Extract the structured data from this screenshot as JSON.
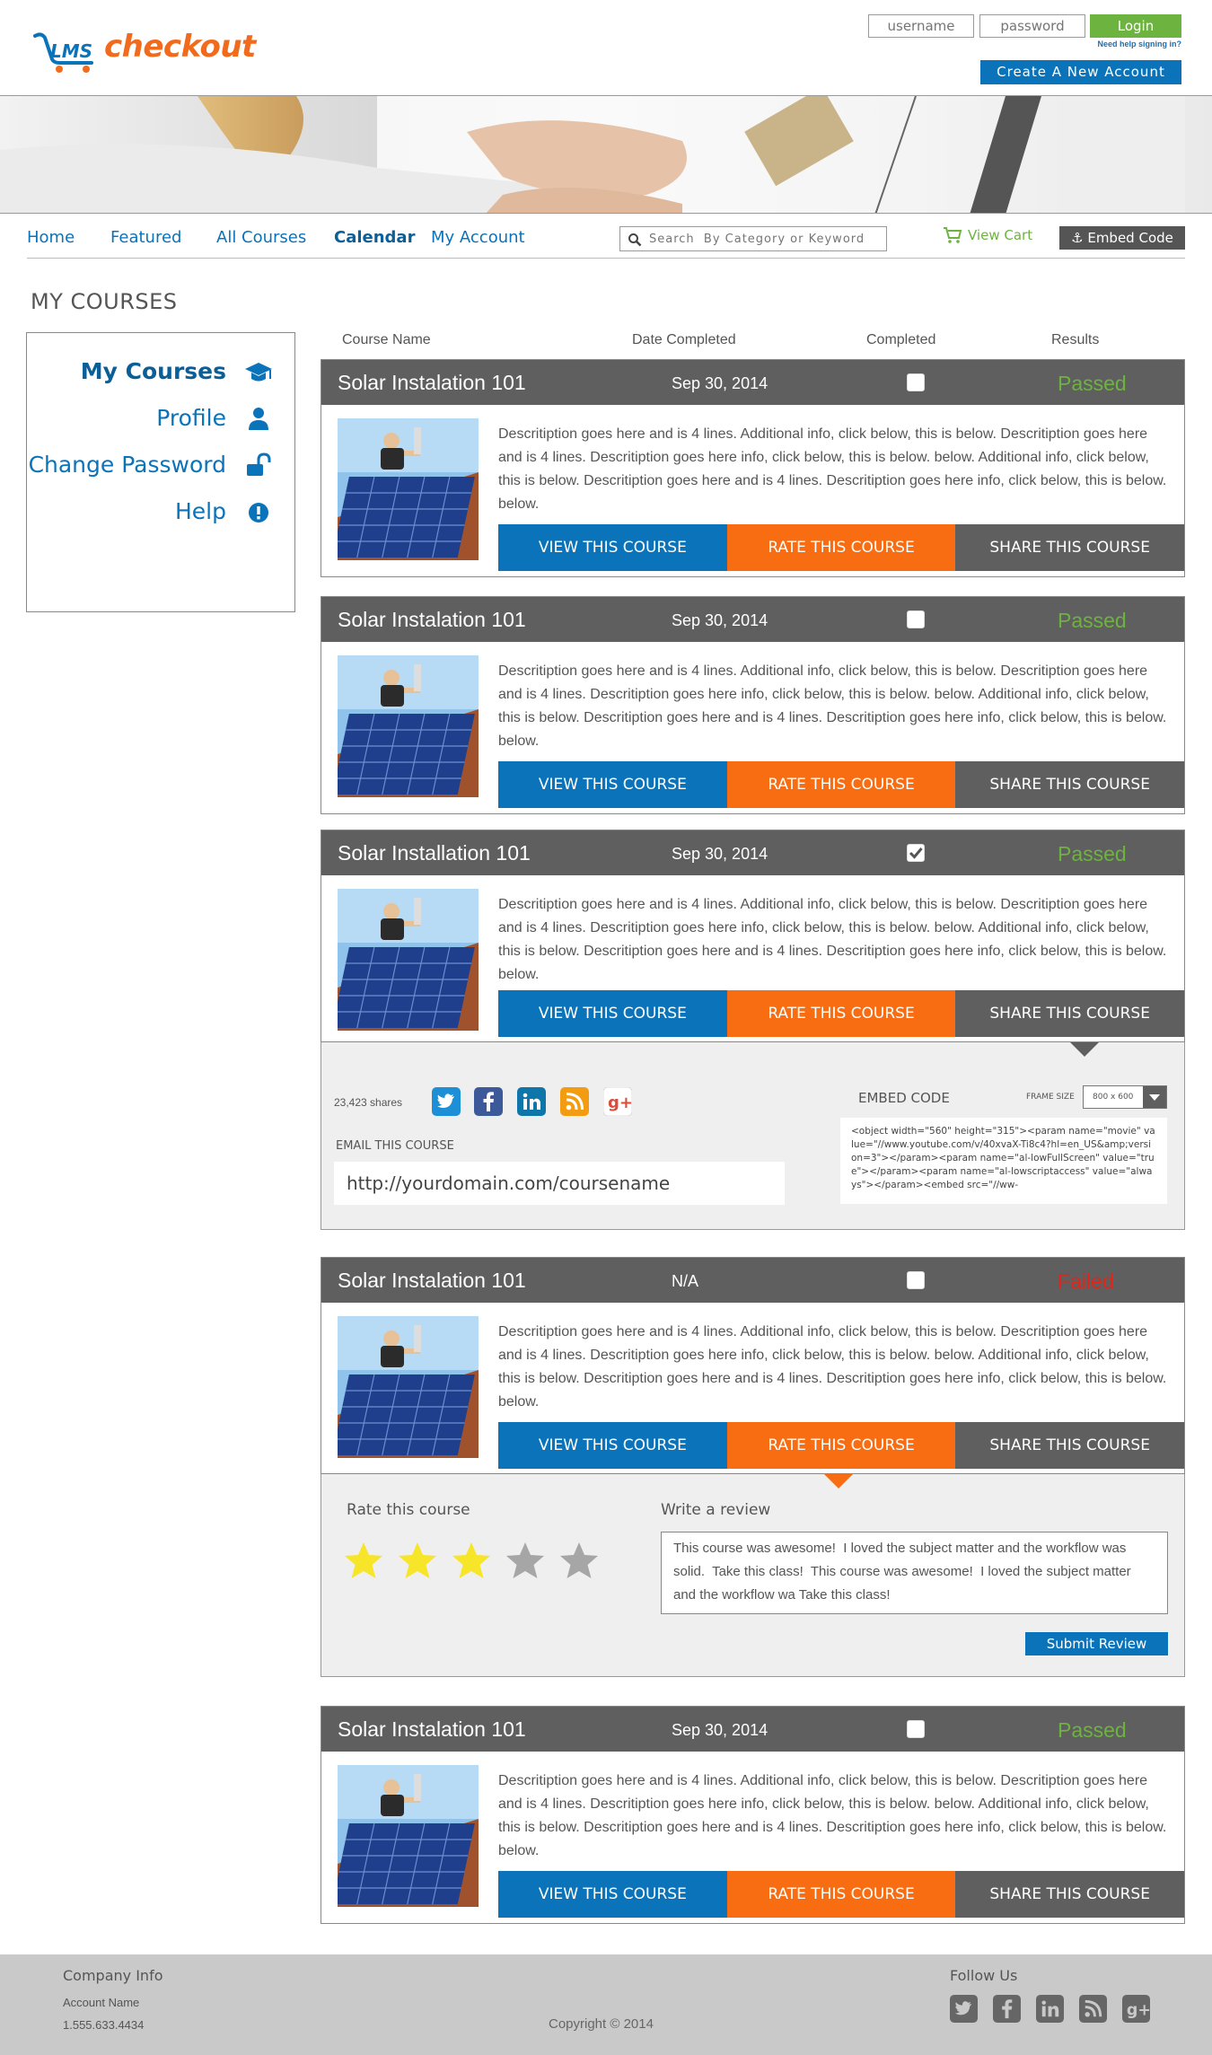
{
  "header": {
    "logo_text": "checkout",
    "logo_mark": "LMS",
    "username_placeholder": "username",
    "password_placeholder": "password",
    "login_label": "Login",
    "help_link": "Need help signing in?",
    "create_account_label": "Create  A  New  Account"
  },
  "nav": {
    "items": [
      "Home",
      "Featured",
      "All Courses",
      "Calendar",
      "My Account"
    ],
    "active": "Calendar",
    "search_placeholder": "Search  By Category or Keyword",
    "cart_label": "View Cart",
    "embed_label": "Embed Code"
  },
  "page_title": "MY COURSES",
  "sidebar": {
    "items": [
      {
        "label": "My Courses",
        "icon": "graduation-cap-icon",
        "active": true
      },
      {
        "label": "Profile",
        "icon": "user-icon",
        "active": false
      },
      {
        "label": "Change Password",
        "icon": "unlock-icon",
        "active": false
      },
      {
        "label": "Help",
        "icon": "exclamation-circle-icon",
        "active": false
      }
    ]
  },
  "columns": [
    "Course Name",
    "Date Completed",
    "Completed",
    "Results"
  ],
  "course_buttons": {
    "view": "VIEW THIS COURSE",
    "rate": "RATE THIS COURSE",
    "share": "SHARE THIS COURSE"
  },
  "courses": [
    {
      "name": "Solar Instalation 101",
      "date": "Sep 30, 2014",
      "completed": false,
      "result": "Passed",
      "result_color": "#6db33f",
      "description": "Descritiption goes here and is 4 lines.  Additional info, click below, this is below. Descritiption goes here and is 4 lines.  Descritiption goes here info, click below, this is below. below.  Additional info, click below, this is below. Descritiption goes here and is 4 lines.  Descritiption goes here info, click below, this is below. below."
    },
    {
      "name": "Solar Instalation 101",
      "date": "Sep 30, 2014",
      "completed": false,
      "result": "Passed",
      "result_color": "#6db33f",
      "description": "Descritiption goes here and is 4 lines.  Additional info, click below, this is below. Descritiption goes here and is 4 lines.  Descritiption goes here info, click below, this is below. below.  Additional info, click below, this is below. Descritiption goes here and is 4 lines.  Descritiption goes here info, click below, this is below. below."
    },
    {
      "name": "Solar Installation 101",
      "date": "Sep 30, 2014",
      "completed": true,
      "result": "Passed",
      "result_color": "#6db33f",
      "description": "Descritiption goes here and is 4 lines.  Additional info, click below, this is below. Descritiption goes here and is 4 lines.  Descritiption goes here info, click below, this is below. below.  Additional info, click below, this is below. Descritiption goes here and is 4 lines.  Descritiption goes here info, click below, this is below. below."
    },
    {
      "name": "Solar Instalation 101",
      "date": "N/A",
      "completed": false,
      "result": "Failed",
      "result_color": "#e0251b",
      "description": "Descritiption goes here and is 4 lines.  Additional info, click below, this is below. Descritiption goes here and is 4 lines.  Descritiption goes here info, click below, this is below. below.  Additional info, click below, this is below. Descritiption goes here and is 4 lines.  Descritiption goes here info, click below, this is below. below."
    },
    {
      "name": "Solar Instalation 101",
      "date": "Sep 30, 2014",
      "completed": false,
      "result": "Passed",
      "result_color": "#6db33f",
      "description": "Descritiption goes here and is 4 lines.  Additional info, click below, this is below. Descritiption goes here and is 4 lines.  Descritiption goes here info, click below, this is below. below.  Additional info, click below, this is below. Descritiption goes here and is 4 lines.  Descritiption goes here info, click below, this is below. below."
    }
  ],
  "share_panel": {
    "share_count": "23,423 shares",
    "social_icons": [
      "twitter-icon",
      "facebook-icon",
      "linkedin-icon",
      "rss-icon",
      "google-plus-icon"
    ],
    "email_label": "EMAIL THIS COURSE",
    "email_value": "http://yourdomain.com/coursename",
    "embed_label": "EMBED CODE",
    "frame_size_label": "FRAME SIZE",
    "frame_size_value": "800 x 600",
    "embed_code": "<object width=\"560\" height=\"315\"><param name=\"movie\" value=\"//www.youtube.com/v/40xvaX-Ti8c4?hl=en_US&amp;version=3\"></param><param name=\"al-lowFullScreen\" value=\"true\"></param><param name=\"al-lowscriptaccess\" value=\"always\"></param><embed src=\"//ww-"
  },
  "rate_panel": {
    "rate_label": "Rate this course",
    "rating": 3,
    "max_rating": 5,
    "review_label": "Write a review",
    "review_text": "This course was awesome!  I loved the subject matter and the workflow was solid.  Take this class!  This course was awesome!  I loved the subject matter and the workflow wa Take this class!",
    "submit_label": "Submit Review"
  },
  "footer": {
    "company_title": "Company Info",
    "account_name": "Account Name",
    "phone": "1.555.633.4434",
    "copyright": "Copyright © 2014",
    "follow_title": "Follow Us",
    "social_icons": [
      "twitter-icon",
      "facebook-icon",
      "linkedin-icon",
      "rss-icon",
      "google-plus-icon"
    ]
  },
  "colors": {
    "brand_blue": "#0a73ba",
    "brand_orange": "#f86c12",
    "brand_green": "#6db33f",
    "header_gray": "#5f5f5f",
    "failed_red": "#e0251b"
  }
}
